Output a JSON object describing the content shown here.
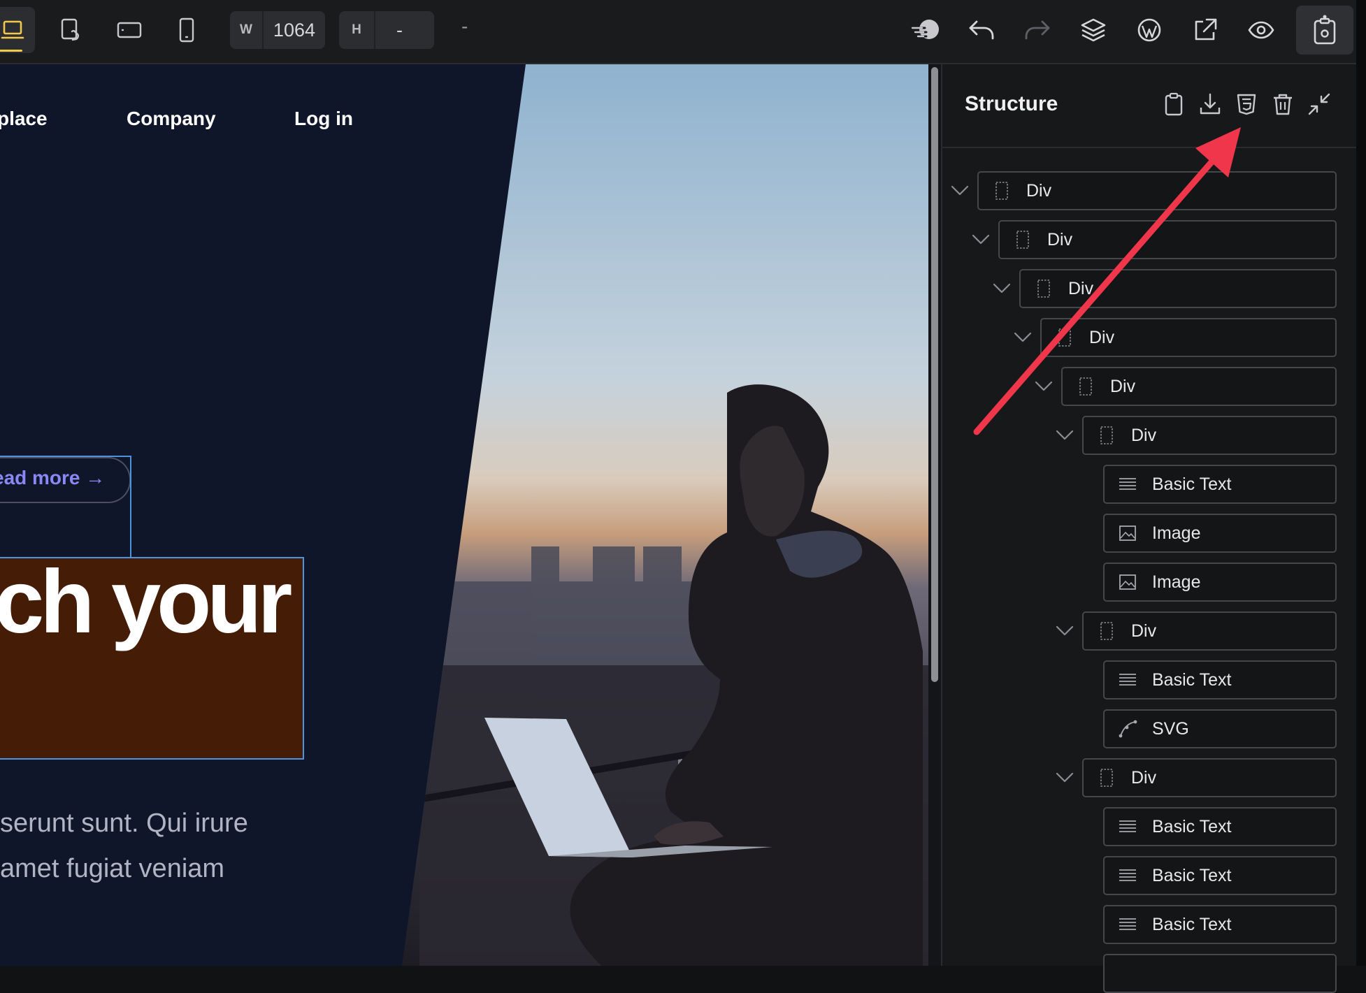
{
  "toolbar": {
    "width_label": "W",
    "width_value": "1064",
    "height_label": "H",
    "height_value": "-",
    "separator": "-"
  },
  "canvas": {
    "nav": [
      "place",
      "Company",
      "Log in"
    ],
    "read_more": "ead more →",
    "headline": "ch your",
    "paragraph_lines": [
      "serunt sunt. Qui irure",
      "amet fugiat veniam"
    ]
  },
  "structure": {
    "title": "Structure",
    "nodes": [
      {
        "label": "Div",
        "type": "div",
        "depth": 0,
        "expand": true
      },
      {
        "label": "Div",
        "type": "div",
        "depth": 1,
        "expand": true
      },
      {
        "label": "Div",
        "type": "div",
        "depth": 2,
        "expand": true
      },
      {
        "label": "Div",
        "type": "div",
        "depth": 3,
        "expand": true
      },
      {
        "label": "Div",
        "type": "div",
        "depth": 4,
        "expand": true
      },
      {
        "label": "Div",
        "type": "div",
        "depth": 5,
        "expand": true
      },
      {
        "label": "Basic Text",
        "type": "text",
        "depth": 6,
        "expand": false
      },
      {
        "label": "Image",
        "type": "image",
        "depth": 6,
        "expand": false
      },
      {
        "label": "Image",
        "type": "image",
        "depth": 6,
        "expand": false
      },
      {
        "label": "Div",
        "type": "div",
        "depth": 5,
        "expand": true
      },
      {
        "label": "Basic Text",
        "type": "text",
        "depth": 6,
        "expand": false
      },
      {
        "label": "SVG",
        "type": "svg",
        "depth": 6,
        "expand": false
      },
      {
        "label": "Div",
        "type": "div",
        "depth": 5,
        "expand": true
      },
      {
        "label": "Basic Text",
        "type": "text",
        "depth": 6,
        "expand": false
      },
      {
        "label": "Basic Text",
        "type": "text",
        "depth": 6,
        "expand": false
      },
      {
        "label": "Basic Text",
        "type": "text",
        "depth": 6,
        "expand": false
      }
    ]
  },
  "colors": {
    "accent": "#f2c94c",
    "selection": "#4f93df",
    "annotation_arrow": "#f0364a",
    "canvas_bg": "#101629"
  },
  "icons": [
    "desktop-icon",
    "tablet-touch-icon",
    "tablet-landscape-icon",
    "phone-icon",
    "wind-icon",
    "undo-icon",
    "redo-icon",
    "layers-icon",
    "wordpress-icon",
    "external-link-icon",
    "eye-icon",
    "publish-icon",
    "clipboard-icon",
    "download-icon",
    "html5-icon",
    "trash-icon",
    "collapse-icon"
  ]
}
